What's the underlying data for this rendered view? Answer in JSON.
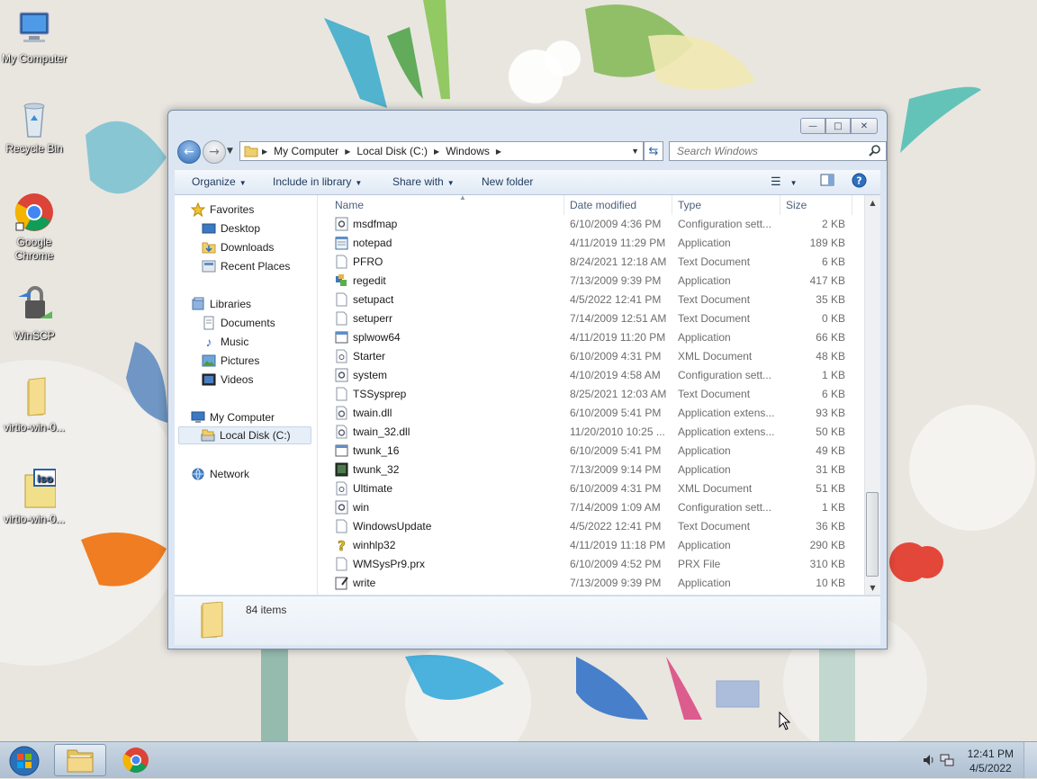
{
  "desktop": {
    "icons": [
      {
        "label": "My Computer",
        "icon": "monitor-icon"
      },
      {
        "label": "Recycle Bin",
        "icon": "recycle-bin-icon"
      },
      {
        "label": "Google Chrome",
        "icon": "chrome-icon"
      },
      {
        "label": "WinSCP",
        "icon": "winscp-icon"
      },
      {
        "label": "virtio-win-0...",
        "icon": "folder-icon"
      },
      {
        "label": "virtio-win-0...",
        "icon": "iso-file-icon"
      }
    ]
  },
  "window": {
    "address": {
      "crumbs": [
        "My Computer",
        "Local Disk (C:)",
        "Windows"
      ]
    },
    "search": {
      "placeholder": "Search Windows"
    },
    "toolbar": {
      "organize": "Organize",
      "include_in_library": "Include in library",
      "share_with": "Share with",
      "new_folder": "New folder"
    },
    "nav": {
      "favorites": "Favorites",
      "desktop": "Desktop",
      "downloads": "Downloads",
      "recent_places": "Recent Places",
      "libraries": "Libraries",
      "documents": "Documents",
      "music": "Music",
      "pictures": "Pictures",
      "videos": "Videos",
      "my_computer": "My Computer",
      "local_disk": "Local Disk (C:)",
      "network": "Network"
    },
    "columns": {
      "name": "Name",
      "date": "Date modified",
      "type": "Type",
      "size": "Size"
    },
    "files": [
      {
        "name": "msdfmap",
        "date": "6/10/2009 4:36 PM",
        "type": "Configuration sett...",
        "size": "2 KB",
        "icon": "config-file-icon"
      },
      {
        "name": "notepad",
        "date": "4/11/2019 11:29 PM",
        "type": "Application",
        "size": "189 KB",
        "icon": "notepad-icon"
      },
      {
        "name": "PFRO",
        "date": "8/24/2021 12:18 AM",
        "type": "Text Document",
        "size": "6 KB",
        "icon": "text-file-icon"
      },
      {
        "name": "regedit",
        "date": "7/13/2009 9:39 PM",
        "type": "Application",
        "size": "417 KB",
        "icon": "regedit-icon"
      },
      {
        "name": "setupact",
        "date": "4/5/2022 12:41 PM",
        "type": "Text Document",
        "size": "35 KB",
        "icon": "text-file-icon"
      },
      {
        "name": "setuperr",
        "date": "7/14/2009 12:51 AM",
        "type": "Text Document",
        "size": "0 KB",
        "icon": "text-file-icon"
      },
      {
        "name": "splwow64",
        "date": "4/11/2019 11:20 PM",
        "type": "Application",
        "size": "66 KB",
        "icon": "application-icon"
      },
      {
        "name": "Starter",
        "date": "6/10/2009 4:31 PM",
        "type": "XML Document",
        "size": "48 KB",
        "icon": "xml-file-icon"
      },
      {
        "name": "system",
        "date": "4/10/2019 4:58 AM",
        "type": "Configuration sett...",
        "size": "1 KB",
        "icon": "config-file-icon"
      },
      {
        "name": "TSSysprep",
        "date": "8/25/2021 12:03 AM",
        "type": "Text Document",
        "size": "6 KB",
        "icon": "text-file-icon"
      },
      {
        "name": "twain.dll",
        "date": "6/10/2009 5:41 PM",
        "type": "Application extens...",
        "size": "93 KB",
        "icon": "dll-file-icon"
      },
      {
        "name": "twain_32.dll",
        "date": "11/20/2010 10:25 ...",
        "type": "Application extens...",
        "size": "50 KB",
        "icon": "dll-file-icon"
      },
      {
        "name": "twunk_16",
        "date": "6/10/2009 5:41 PM",
        "type": "Application",
        "size": "49 KB",
        "icon": "application-icon"
      },
      {
        "name": "twunk_32",
        "date": "7/13/2009 9:14 PM",
        "type": "Application",
        "size": "31 KB",
        "icon": "twunk-icon"
      },
      {
        "name": "Ultimate",
        "date": "6/10/2009 4:31 PM",
        "type": "XML Document",
        "size": "51 KB",
        "icon": "xml-file-icon"
      },
      {
        "name": "win",
        "date": "7/14/2009 1:09 AM",
        "type": "Configuration sett...",
        "size": "1 KB",
        "icon": "config-file-icon"
      },
      {
        "name": "WindowsUpdate",
        "date": "4/5/2022 12:41 PM",
        "type": "Text Document",
        "size": "36 KB",
        "icon": "text-file-icon"
      },
      {
        "name": "winhlp32",
        "date": "4/11/2019 11:18 PM",
        "type": "Application",
        "size": "290 KB",
        "icon": "help-icon"
      },
      {
        "name": "WMSysPr9.prx",
        "date": "6/10/2009 4:52 PM",
        "type": "PRX File",
        "size": "310 KB",
        "icon": "blank-file-icon"
      },
      {
        "name": "write",
        "date": "7/13/2009 9:39 PM",
        "type": "Application",
        "size": "10 KB",
        "icon": "wordpad-icon"
      }
    ],
    "status": {
      "item_count": "84 items"
    }
  },
  "taskbar": {
    "time": "12:41 PM",
    "date": "4/5/2022"
  }
}
